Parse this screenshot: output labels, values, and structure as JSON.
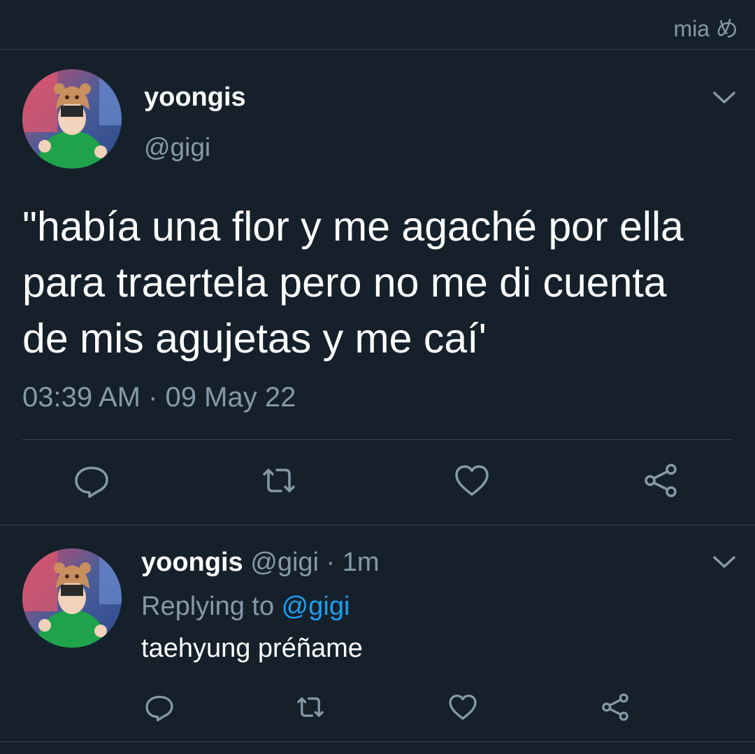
{
  "status_bar": {
    "label": "mia め"
  },
  "tweet": {
    "display_name": "yoongis",
    "handle": "@gigi",
    "text": "\"había una flor y me agaché por ella\npara traertela pero no me di cuenta\nde mis agujetas y me caí'",
    "timestamp": "03:39 AM · 09 May 22",
    "actions": [
      "reply-icon",
      "retweet-icon",
      "like-icon",
      "share-icon"
    ]
  },
  "reply": {
    "display_name": "yoongis",
    "meta": " @gigi · 1m",
    "replying_prefix": "Replying to ",
    "replying_handle": "@gigi",
    "text": "taehyung préñame",
    "actions": [
      "reply-icon",
      "retweet-icon",
      "like-icon",
      "share-icon"
    ]
  },
  "colors": {
    "background": "#15202b",
    "secondary_text": "#8899a6",
    "link": "#1da1f2",
    "divider": "#38444d"
  }
}
